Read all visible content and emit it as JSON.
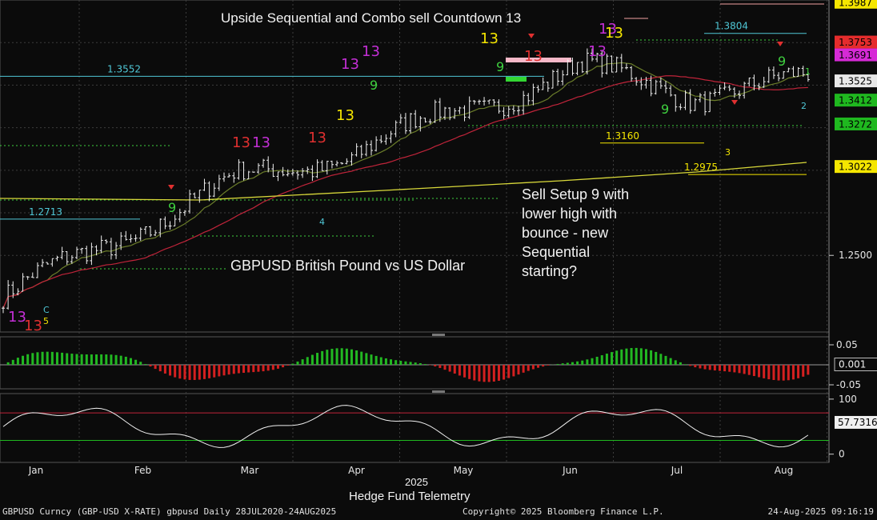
{
  "annotations": {
    "title": "Upside Sequential and Combo sell Countdown 13",
    "instrument": "GBPUSD British Pound vs US Dollar",
    "comment_lines": [
      "Sell Setup 9 with",
      "lower high with",
      "bounce - new",
      "Sequential",
      "starting?"
    ],
    "level_labels": [
      "1.3552",
      "1.2713",
      "1.3804",
      "1.3160",
      "1.2975"
    ]
  },
  "footer": {
    "x_axis_year": "2025",
    "subtitle": "Hedge Fund Telemetry",
    "ticker_info": "GBPUSD Curncy (GBP-USD X-RATE) gbpusd  Daily 28JUL2020-24AUG2025",
    "copyright": "Copyright© 2025 Bloomberg Finance L.P.",
    "timestamp": "24-Aug-2025 09:16:19"
  },
  "colors": {
    "background": "#0b0b0b",
    "grid": "#3d3d3d",
    "candles": "#f0f0f0",
    "ma_fast": "#6b7d2a",
    "ma_slow": "#c0243a",
    "ma_long": "#d8d83a",
    "buy_count": "#3fd13f",
    "sell_count": "#e03030",
    "countdown_13": "#c42fd6",
    "resistance": "#4fc7d6",
    "histogram_pos": "#22b822",
    "histogram_neg": "#d42020",
    "badge_yellow": "#f5e600",
    "badge_green": "#1fb81f",
    "badge_red": "#e52c2c",
    "badge_magenta": "#d62ad6",
    "badge_white": "#e8e8e8"
  },
  "chart_data": [
    {
      "type": "candlestick",
      "panel": "price",
      "x_ticks": [
        "Jan",
        "Feb",
        "Mar",
        "Apr",
        "May",
        "Jun",
        "Jul",
        "Aug"
      ],
      "y_ticks": [
        1.25
      ],
      "ylim": [
        1.205,
        1.4
      ],
      "price_badges": [
        {
          "value": 1.3987,
          "color": "yellow"
        },
        {
          "value": 1.3753,
          "color": "red"
        },
        {
          "value": 1.3691,
          "color": "magenta"
        },
        {
          "value": 1.3525,
          "color": "white"
        },
        {
          "value": 1.3412,
          "color": "green"
        },
        {
          "value": 1.3272,
          "color": "green"
        },
        {
          "value": 1.3022,
          "color": "yellow"
        }
      ],
      "resistance_levels": [
        1.3552,
        1.2713,
        1.3804,
        1.316,
        1.2975
      ],
      "approx_close_by_month": [
        {
          "x": "Jan",
          "close": 1.225
        },
        {
          "x": "Feb",
          "close": 1.26
        },
        {
          "x": "Mar",
          "close": 1.293
        },
        {
          "x": "Apr",
          "close": 1.31
        },
        {
          "x": "May",
          "close": 1.335
        },
        {
          "x": "Jun",
          "close": 1.36
        },
        {
          "x": "Jul",
          "close": 1.345
        },
        {
          "x": "Aug",
          "close": 1.352
        }
      ]
    },
    {
      "type": "bar",
      "panel": "momentum-histogram",
      "y_ticks": [
        0.05,
        -0.05
      ],
      "ylim": [
        -0.06,
        0.07
      ],
      "last_value": 0.001
    },
    {
      "type": "line",
      "panel": "oscillator",
      "y_ticks": [
        100,
        0
      ],
      "ylim": [
        -15,
        110
      ],
      "bands": [
        75,
        25
      ],
      "last_value": 57.7316
    }
  ]
}
